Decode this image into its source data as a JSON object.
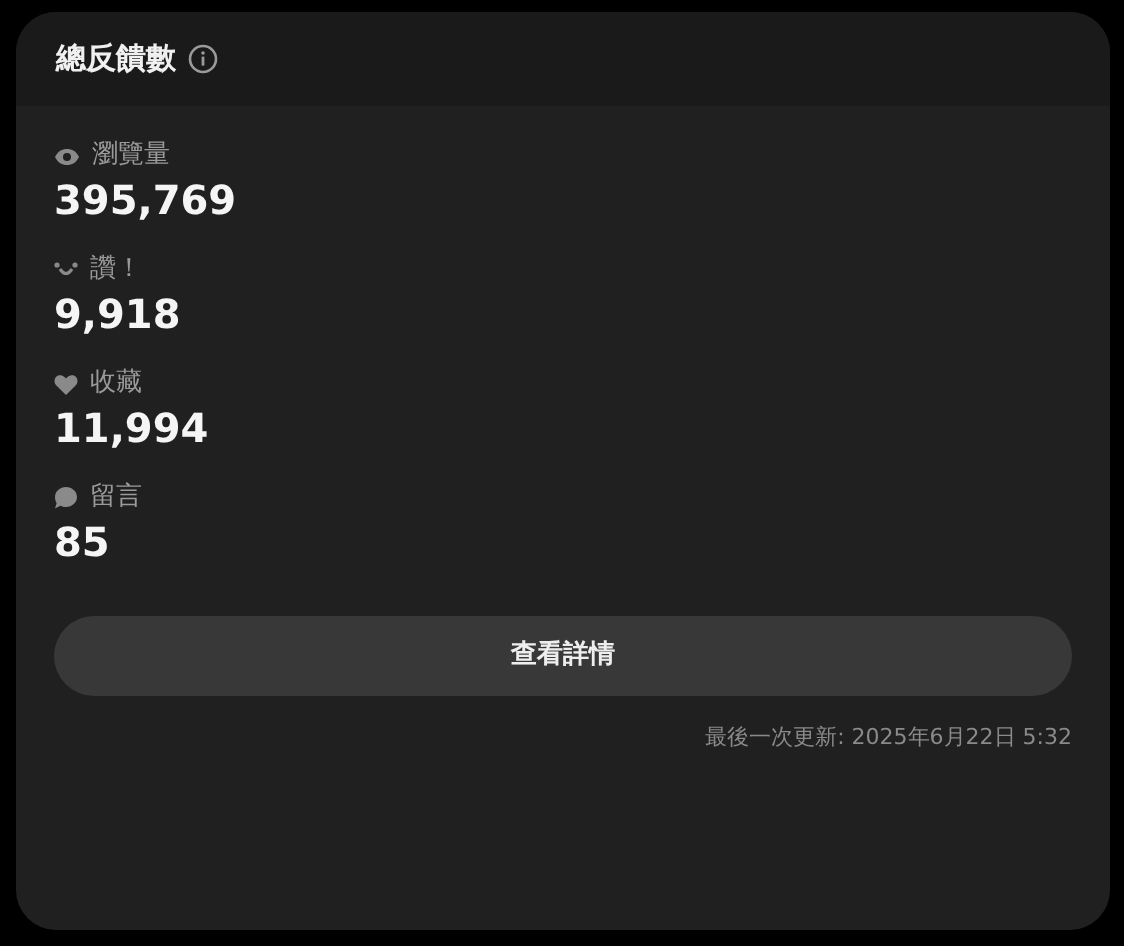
{
  "card": {
    "title": "總反饋數",
    "stats": [
      {
        "kind": "views",
        "label": "瀏覽量",
        "value": "395,769"
      },
      {
        "kind": "likes",
        "label": "讚！",
        "value": "9,918"
      },
      {
        "kind": "favorites",
        "label": "收藏",
        "value": "11,994"
      },
      {
        "kind": "comments",
        "label": "留言",
        "value": "85"
      }
    ],
    "button": "查看詳情",
    "updated": "最後一次更新: 2025年6月22日 5:32"
  }
}
